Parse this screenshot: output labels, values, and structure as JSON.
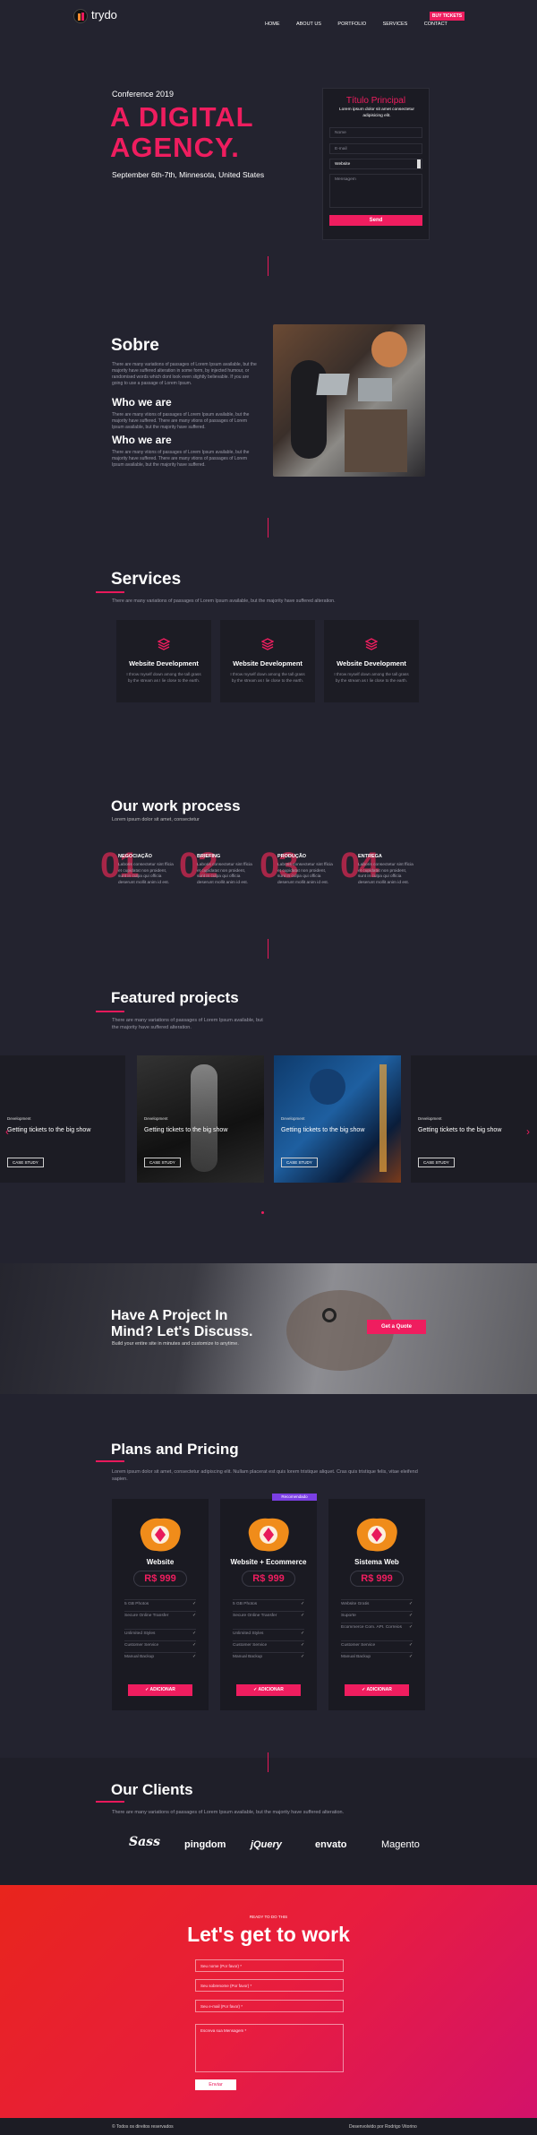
{
  "brand": {
    "name": "trydo"
  },
  "nav": {
    "items": [
      "HOME",
      "ABOUT US",
      "PORTFOLIO",
      "SERVICES",
      "CONTACT"
    ],
    "cta": "BUY TICKETS"
  },
  "hero": {
    "kicker": "Conference 2019",
    "title1": "A DIGITAL",
    "title2": "AGENCY.",
    "date": "September 6th-7th, Minnesota, United States"
  },
  "form": {
    "title": "Título Principal",
    "subtitle": "Lorem ipsum dolor sit amet consectetur adipisicing elit.",
    "name": "Nome",
    "email": "E-mail",
    "website": "Website",
    "message": "Mensagem",
    "submit": "Send"
  },
  "about": {
    "title": "Sobre",
    "p1": "There are many variations of passages of Lorem Ipsum available, but the majority have suffered alteration in some form, by injected humour, or randomised words which dont look even slightly believable. If you are going to use a passage of Lorem Ipsum.",
    "h2": "Who we are",
    "p2": "There are many vtions of passages of Lorem Ipsum available, but the majority have suffered. There are many vtions of passages of Lorem Ipsum available, but the majority have suffered.",
    "h3": "Who we are",
    "p3": "There are many vtions of passages of Lorem Ipsum available, but the majority have suffered. There are many vtions of passages of Lorem Ipsum available, but the majority have suffered."
  },
  "services": {
    "title": "Services",
    "desc": "There are many variations of passages of Lorem Ipsum available, but the majority have suffered alteration.",
    "items": [
      {
        "title": "Website Development",
        "text": "I throw myself down among the tall grass by the stream as I lie close to the earth."
      },
      {
        "title": "Website Development",
        "text": "I throw myself down among the tall grass by the stream as I lie close to the earth."
      },
      {
        "title": "Website Development",
        "text": "I throw myself down among the tall grass by the stream as I lie close to the earth."
      }
    ]
  },
  "process": {
    "title": "Our work process",
    "subtitle": "Lorem ipsum dolor sit amet, consectetur",
    "steps": [
      {
        "num": "01",
        "title": "NEGOCIAÇÃO",
        "text": "Laboris consectetur sint fficia et cupidatat non proident, sunt in culpa qui officia deserunt mollit anim id est."
      },
      {
        "num": "02",
        "title": "BRIEFING",
        "text": "Laboris consectetur sint fficia et cupidatat non proident, sunt in culpa qui officia deserunt mollit anim id est."
      },
      {
        "num": "03",
        "title": "PRODUÇÃO",
        "text": "Laboris consectetur sint fficia et cupidatat non proident, sunt in culpa qui officia deserunt mollit anim id est."
      },
      {
        "num": "04",
        "title": "ENTREGA",
        "text": "Laboris consectetur sint fficia et cupidatat non proident, sunt in culpa qui officia deserunt mollit anim id est."
      }
    ]
  },
  "projects": {
    "title": "Featured projects",
    "desc": "There are many variations of passages of Lorem Ipsum available, but the majority have suffered alteration.",
    "cards": [
      {
        "cat": "Development",
        "title": "Getting tickets to the big show",
        "btn": "CASE STUDY"
      },
      {
        "cat": "Development",
        "title": "Getting tickets to the big show",
        "btn": "CASE STUDY"
      },
      {
        "cat": "Development",
        "title": "Getting tickets to the big show",
        "btn": "CASE STUDY"
      },
      {
        "cat": "Development",
        "title": "Getting tickets to the big show",
        "btn": "CASE STUDY"
      }
    ]
  },
  "cta": {
    "title1": "Have A Project In",
    "title2": "Mind? Let's Discuss.",
    "sub": "Build your entire site in minutes and customize to anytime.",
    "btn": "Get a Quote"
  },
  "pricing": {
    "title": "Plans and Pricing",
    "desc": "Lorem ipsum dolor sit amet, consectetur adipiscing elit. Nullam placerat est quis lorem tristique aliquet. Cras quis tristique felis, vitae eleifend sapien.",
    "badge": "Recomendado",
    "add": "✓ ADICIONAR",
    "plans": [
      {
        "name": "Website",
        "price": "R$ 999",
        "features": [
          "5 GB Photos",
          "Secure Online Transfer",
          "Unlimited Styles",
          "Customer Service",
          "Manual Backup"
        ]
      },
      {
        "name": "Website + Ecommerce",
        "price": "R$ 999",
        "features": [
          "5 GB Photos",
          "Secure Online Transfer",
          "Unlimited Styles",
          "Customer Service",
          "Manual Backup"
        ]
      },
      {
        "name": "Sistema Web",
        "price": "R$ 999",
        "features": [
          "Website Gratis",
          "Suporte",
          "Ecommerce Com. API. Correios",
          "Customer Service",
          "Manual Backup"
        ]
      }
    ]
  },
  "clients": {
    "title": "Our Clients",
    "desc": "There are many variations of passages of Lorem Ipsum available, but the majority have suffered alteration.",
    "logos": [
      "Sass",
      "pingdom",
      "jQuery",
      "envato",
      "Magento"
    ]
  },
  "contact": {
    "kicker": "READY TO DO THIS",
    "title": "Let's get to work",
    "name": "Seu nome (Por favor) *",
    "lastname": "Seu sobrenome (Por favor) *",
    "email": "Seu e-mail (Por favor) *",
    "message": "Escreva sua Mensagem *",
    "submit": "Enviar"
  },
  "footer": {
    "left": "© Todos os direitos reservados",
    "right": "Desenvolvido por Rodrigo Vitorino"
  }
}
